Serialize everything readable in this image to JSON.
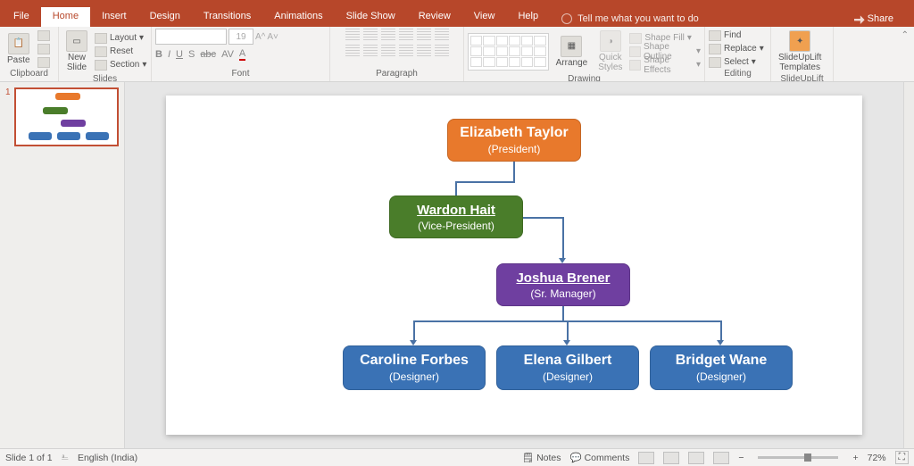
{
  "tabs": {
    "file": "File",
    "home": "Home",
    "insert": "Insert",
    "design": "Design",
    "transitions": "Transitions",
    "animations": "Animations",
    "slideshow": "Slide Show",
    "review": "Review",
    "view": "View",
    "help": "Help",
    "tellme_placeholder": "Tell me what you want to do",
    "share": "Share"
  },
  "ribbon": {
    "clipboard": {
      "label": "Clipboard",
      "paste": "Paste"
    },
    "slides": {
      "label": "Slides",
      "new_slide": "New\nSlide",
      "layout": "Layout",
      "reset": "Reset",
      "section": "Section"
    },
    "font": {
      "label": "Font",
      "font_name": "",
      "font_size": "19",
      "b": "B",
      "i": "I",
      "u": "U",
      "s": "S",
      "abc": "abc",
      "av": "AV"
    },
    "paragraph": {
      "label": "Paragraph"
    },
    "drawing": {
      "label": "Drawing",
      "arrange": "Arrange",
      "quick_styles": "Quick\nStyles",
      "shape_fill": "Shape Fill",
      "shape_outline": "Shape Outline",
      "shape_effects": "Shape Effects"
    },
    "editing": {
      "label": "Editing",
      "find": "Find",
      "replace": "Replace",
      "select": "Select"
    },
    "slideuplift": {
      "label": "SlideUpLift",
      "templates": "SlideUpLift\nTemplates"
    }
  },
  "thumbnail": {
    "number": "1"
  },
  "org_chart": {
    "president": {
      "name": "Elizabeth Taylor",
      "role": "(President)"
    },
    "vp": {
      "name": "Wardon Hait",
      "role": "(Vice-President)"
    },
    "sr_manager": {
      "name": "Joshua Brener",
      "role": "(Sr. Manager)"
    },
    "designers": [
      {
        "name": "Caroline Forbes",
        "role": "(Designer)"
      },
      {
        "name": "Elena Gilbert",
        "role": "(Designer)"
      },
      {
        "name": "Bridget Wane",
        "role": "(Designer)"
      }
    ]
  },
  "status": {
    "slide_info": "Slide 1 of 1",
    "language": "English (India)",
    "notes": "Notes",
    "comments": "Comments",
    "zoom": "72%"
  },
  "chart_data": {
    "type": "diagram",
    "subtype": "org-chart",
    "nodes": [
      {
        "id": "n1",
        "name": "Elizabeth Taylor",
        "role": "President",
        "color": "#e8792c"
      },
      {
        "id": "n2",
        "name": "Wardon Hait",
        "role": "Vice-President",
        "color": "#4a7d2a",
        "parent": "n1"
      },
      {
        "id": "n3",
        "name": "Joshua Brener",
        "role": "Sr. Manager",
        "color": "#6f3fa0",
        "parent": "n2"
      },
      {
        "id": "n4",
        "name": "Caroline Forbes",
        "role": "Designer",
        "color": "#3a72b5",
        "parent": "n3"
      },
      {
        "id": "n5",
        "name": "Elena Gilbert",
        "role": "Designer",
        "color": "#3a72b5",
        "parent": "n3"
      },
      {
        "id": "n6",
        "name": "Bridget Wane",
        "role": "Designer",
        "color": "#3a72b5",
        "parent": "n3"
      }
    ]
  }
}
